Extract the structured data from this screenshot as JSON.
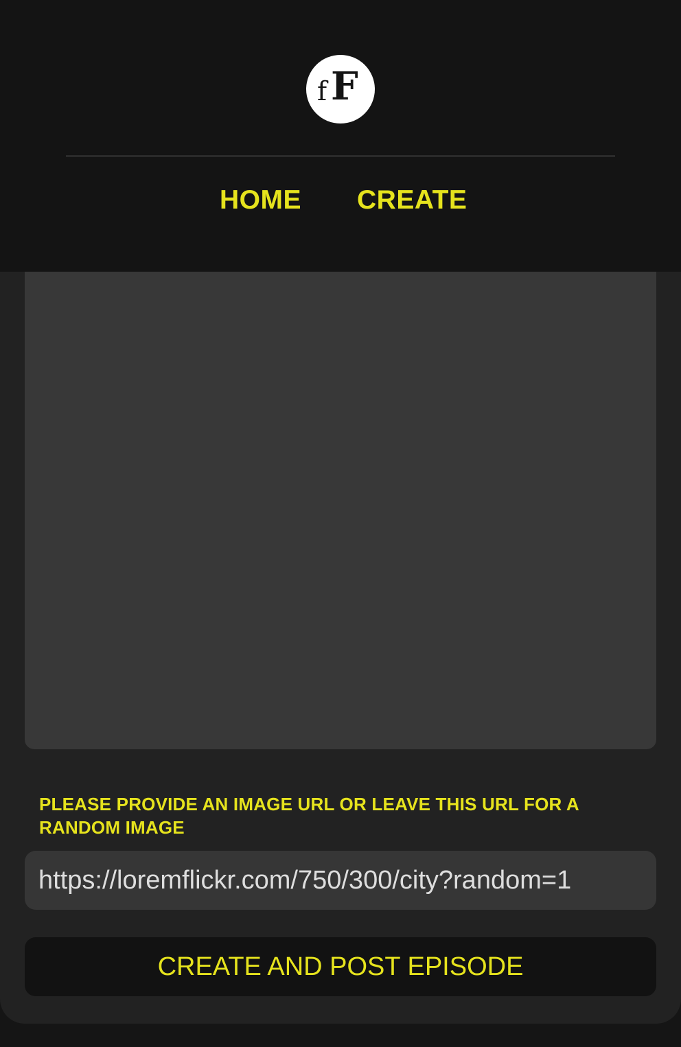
{
  "header": {
    "logo": {
      "small_letter": "f",
      "big_letter": "F"
    },
    "nav": [
      {
        "label": "HOME"
      },
      {
        "label": "CREATE"
      }
    ]
  },
  "form": {
    "image_url_label": "PLEASE PROVIDE AN IMAGE URL OR LEAVE THIS URL FOR A RANDOM IMAGE",
    "image_url_value": "https://loremflickr.com/750/300/city?random=1",
    "submit_label": "CREATE AND POST EPISODE"
  },
  "colors": {
    "accent": "#e6e31d",
    "header_background": "#141414",
    "card_background": "#222222",
    "input_background": "#363636"
  }
}
